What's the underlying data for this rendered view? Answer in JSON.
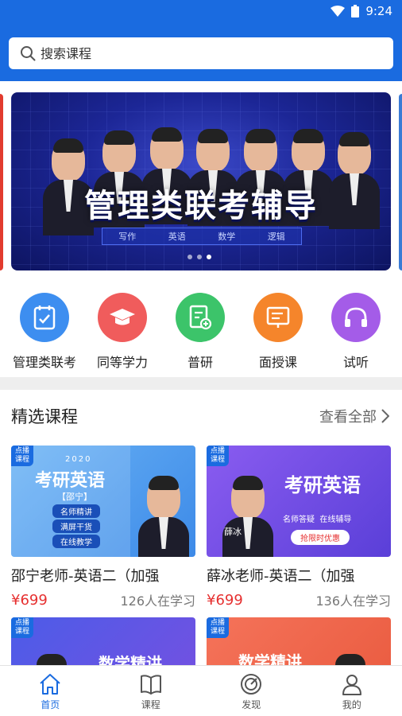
{
  "status": {
    "time": "9:24"
  },
  "search": {
    "placeholder": "搜索课程"
  },
  "banner": {
    "title": "管理类联考辅导",
    "subjects": [
      "写作",
      "英语",
      "数学",
      "逻辑"
    ]
  },
  "categories": [
    {
      "label": "管理类联考",
      "icon": "calendar-check-icon",
      "color": "#3d8ef0"
    },
    {
      "label": "同等学力",
      "icon": "graduation-cap-icon",
      "color": "#f05c5c"
    },
    {
      "label": "普研",
      "icon": "document-add-icon",
      "color": "#3cc46a"
    },
    {
      "label": "面授课",
      "icon": "lecture-icon",
      "color": "#f5852b"
    },
    {
      "label": "试听",
      "icon": "headphones-icon",
      "color": "#a45ce8"
    }
  ],
  "featured": {
    "title": "精选课程",
    "view_all": "查看全部",
    "courses": [
      {
        "tag": "点播课程",
        "name": "邵宁老师-英语二（加强",
        "price": "¥699",
        "learners": "126人在学习",
        "thumb_year": "2020",
        "thumb_title": "考研英语",
        "thumb_teacher": "【邵宁】",
        "thumb_lines": [
          "名师精讲",
          "满屏干货",
          "在线教学"
        ]
      },
      {
        "tag": "点播课程",
        "name": "薛冰老师-英语二（加强",
        "price": "¥699",
        "learners": "136人在学习",
        "thumb_title": "考研英语",
        "thumb_sub": "名师答疑  在线辅导",
        "thumb_button": "抢限时优惠",
        "thumb_teacher": "薛冰"
      },
      {
        "tag": "点播课程",
        "thumb_title": "数学精讲"
      },
      {
        "tag": "点播课程",
        "thumb_title": "数学精讲"
      }
    ]
  },
  "nav": [
    {
      "label": "首页",
      "icon": "home-icon",
      "active": true
    },
    {
      "label": "课程",
      "icon": "book-icon",
      "active": false
    },
    {
      "label": "发现",
      "icon": "compass-icon",
      "active": false
    },
    {
      "label": "我的",
      "icon": "user-icon",
      "active": false
    }
  ],
  "colors": {
    "primary": "#1a6be0",
    "price": "#e63030"
  }
}
